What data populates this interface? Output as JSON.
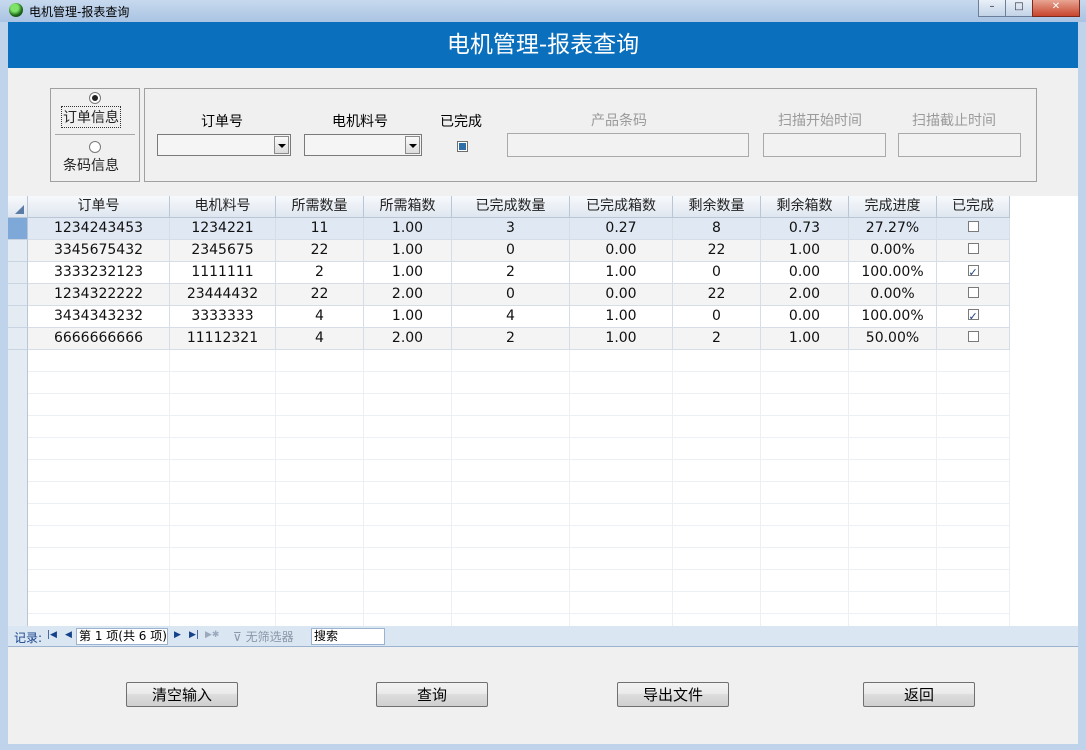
{
  "window": {
    "title": "电机管理-报表查询",
    "controls": {
      "minimize": "–",
      "maximize": "□",
      "close": "✕"
    }
  },
  "header": {
    "title": "电机管理-报表查询"
  },
  "mode": {
    "options": [
      {
        "label": "订单信息",
        "selected": true
      },
      {
        "label": "条码信息",
        "selected": false
      }
    ]
  },
  "filters": {
    "order_no_label": "订单号",
    "motor_part_label": "电机料号",
    "completed_label": "已完成",
    "barcode_label": "产品条码",
    "scan_start_label": "扫描开始时间",
    "scan_end_label": "扫描截止时间"
  },
  "grid": {
    "columns": [
      "订单号",
      "电机料号",
      "所需数量",
      "所需箱数",
      "已完成数量",
      "已完成箱数",
      "剩余数量",
      "剩余箱数",
      "完成进度",
      "已完成"
    ],
    "rows": [
      [
        "1234243453",
        "1234221",
        "11",
        "1.00",
        "3",
        "0.27",
        "8",
        "0.73",
        "27.27%",
        false
      ],
      [
        "3345675432",
        "2345675",
        "22",
        "1.00",
        "0",
        "0.00",
        "22",
        "1.00",
        "0.00%",
        false
      ],
      [
        "3333232123",
        "1111111",
        "2",
        "1.00",
        "2",
        "1.00",
        "0",
        "0.00",
        "100.00%",
        true
      ],
      [
        "1234322222",
        "23444432",
        "22",
        "2.00",
        "0",
        "0.00",
        "22",
        "2.00",
        "0.00%",
        false
      ],
      [
        "3434343232",
        "3333333",
        "4",
        "1.00",
        "4",
        "1.00",
        "0",
        "0.00",
        "100.00%",
        true
      ],
      [
        "6666666666",
        "11112321",
        "4",
        "2.00",
        "2",
        "1.00",
        "2",
        "1.00",
        "50.00%",
        false
      ]
    ]
  },
  "navigator": {
    "record_label": "记录:",
    "position": "第 1 项(共 6 项)",
    "no_filter": "无筛选器",
    "search": "搜索"
  },
  "buttons": {
    "clear": "清空输入",
    "query": "查询",
    "export": "导出文件",
    "back": "返回"
  },
  "colors": {
    "header_bg": "#0a6fbd",
    "accent": "#2d6ea8"
  }
}
